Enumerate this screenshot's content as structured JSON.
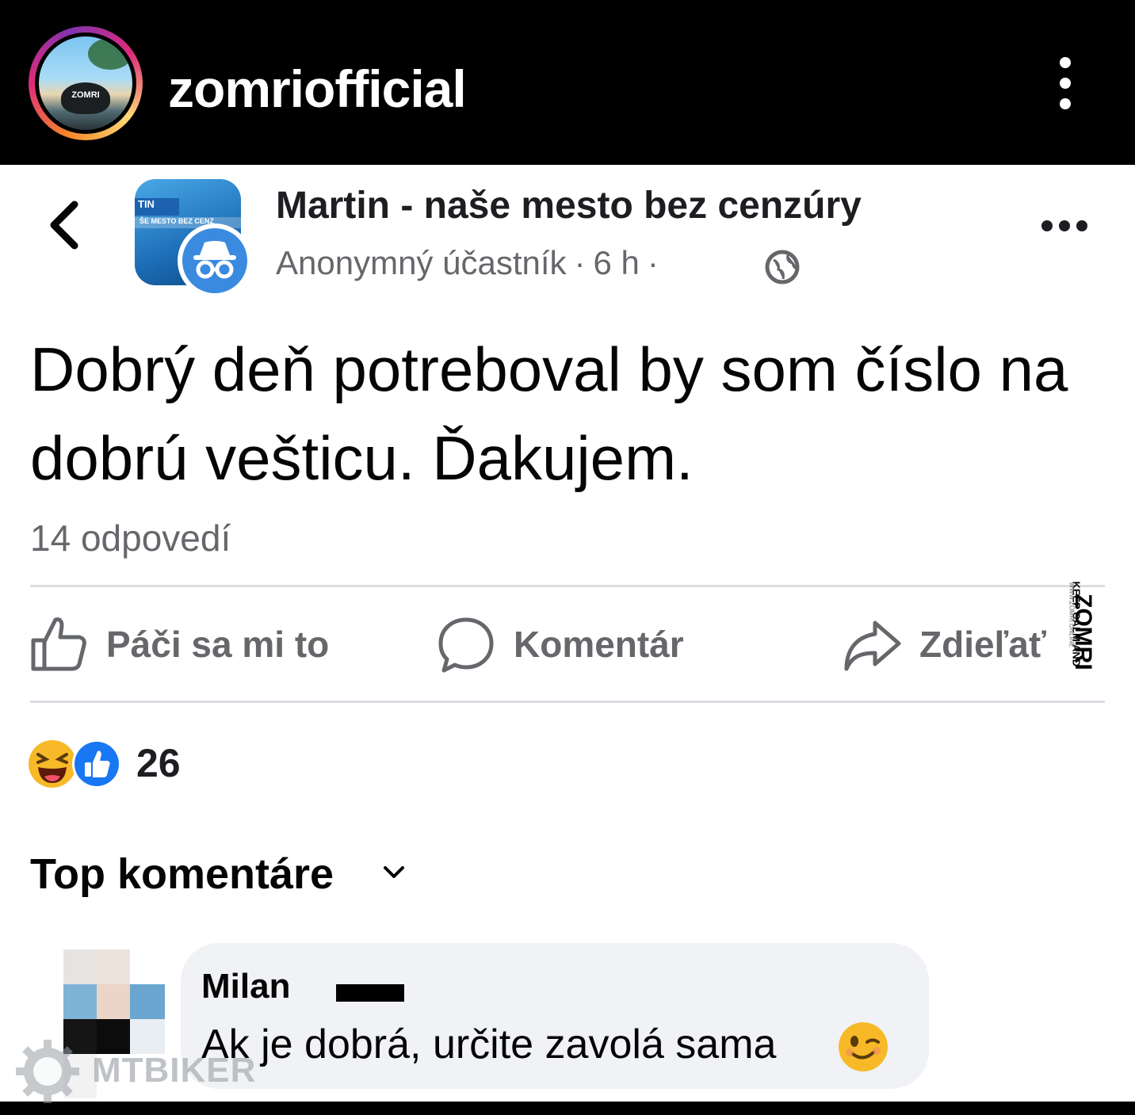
{
  "instagram": {
    "username": "zomriofficial",
    "avatar_label": "ZOMRI"
  },
  "post": {
    "group_avatar_tag": "TIN",
    "group_avatar_sub": "ŠE MESTO BEZ CENZ",
    "group_name": "Martin - naše mesto bez cenzúry",
    "author": "Anonymný účastník",
    "time": "6 h",
    "privacy_icon": "globe-icon",
    "text": "Dobrý deň potreboval by som číslo na dobrú vešticu. Ďakujem.",
    "replies": "14 odpovedí"
  },
  "actions": {
    "like_label": "Páči sa mi to",
    "comment_label": "Komentár",
    "share_label": "Zdieľať"
  },
  "watermark": {
    "brand_top": "KEEP CALM AND",
    "brand_main": "ZOMRI",
    "brand_url": "WWW.ZOMRI.ONLINE"
  },
  "reactions": {
    "count": "26",
    "types": [
      "haha-emoji-icon",
      "like-reaction-icon"
    ]
  },
  "comments_section": {
    "sort_label": "Top komentáre"
  },
  "comment": {
    "author": "Milan",
    "text": "Ak je dobrá, určite zavolá sama",
    "emoji": "wink-emoji-icon"
  },
  "overlay": {
    "site_watermark": "MTBIKER"
  },
  "colors": {
    "meta_gray": "#65676b",
    "divider": "#dadde1",
    "bubble": "#f0f2f5",
    "fb_blue": "#1877f2"
  }
}
